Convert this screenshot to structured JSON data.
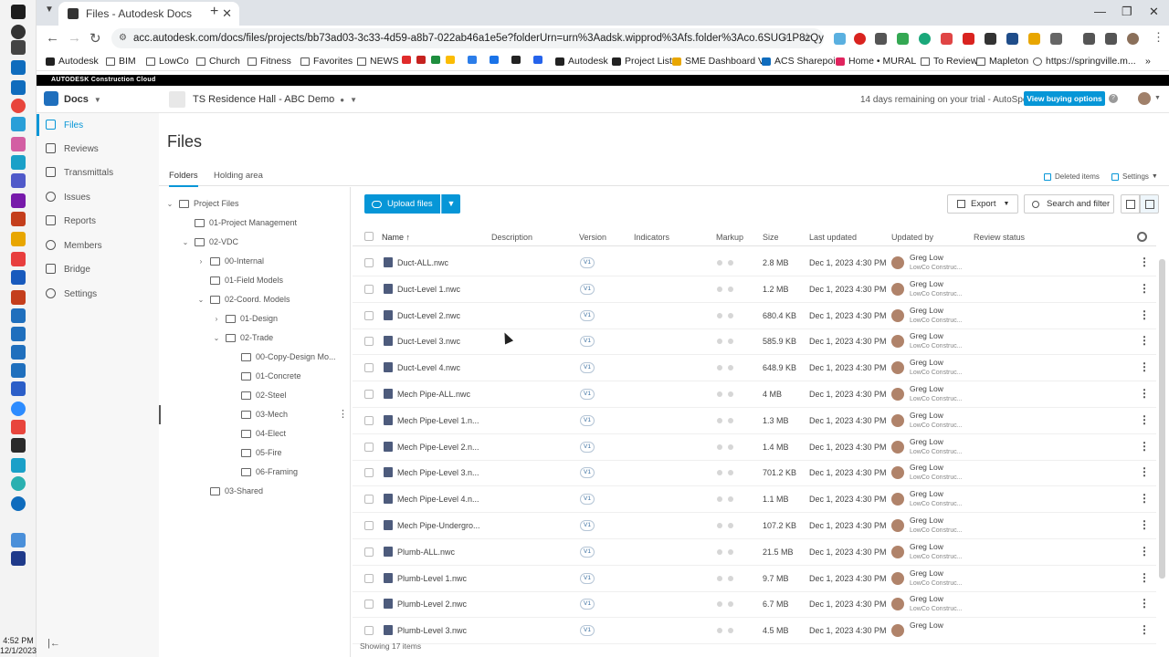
{
  "system": {
    "time": "4:52 PM",
    "date": "12/1/2023"
  },
  "browser": {
    "tab_title": "Files - Autodesk Docs",
    "url": "acc.autodesk.com/docs/files/projects/bb73ad03-3c33-4d59-a8b7-022ab46a1e5e?folderUrn=urn%3Aadsk.wipprod%3Afs.folder%3Aco.6SUG1P8zQySaFDJ7BnrHIA&viewM...",
    "bookmarks": [
      "Autodesk",
      "BIM",
      "LowCo",
      "Church",
      "Fitness",
      "Favorites",
      "NEWS",
      "Autodesk",
      "Project List",
      "SME Dashboard V3",
      "ACS Sharepoint",
      "Home • MURAL",
      "To Review",
      "Mapleton",
      "https://springville.m..."
    ]
  },
  "acc": {
    "brand_bar": "AUTODESK Construction Cloud",
    "module": "Docs",
    "project": "TS Residence Hall - ABC Demo",
    "trial_text": "14 days remaining on your trial - AutoSpecs",
    "buy_button": "View buying options",
    "help": "?"
  },
  "nav": {
    "items": [
      {
        "label": "Files",
        "active": true
      },
      {
        "label": "Reviews"
      },
      {
        "label": "Transmittals"
      },
      {
        "label": "Issues"
      },
      {
        "label": "Reports"
      },
      {
        "label": "Members"
      },
      {
        "label": "Bridge"
      },
      {
        "label": "Settings"
      }
    ]
  },
  "page": {
    "title": "Files",
    "tabs": [
      "Folders",
      "Holding area"
    ],
    "deleted_items": "Deleted items",
    "settings": "Settings"
  },
  "tree": [
    {
      "label": "Project Files",
      "depth": 0,
      "chevron": "v"
    },
    {
      "label": "01-Project Management",
      "depth": 1,
      "chevron": ""
    },
    {
      "label": "02-VDC",
      "depth": 1,
      "chevron": "v"
    },
    {
      "label": "00-Internal",
      "depth": 2,
      "chevron": ">"
    },
    {
      "label": "01-Field Models",
      "depth": 2,
      "chevron": ""
    },
    {
      "label": "02-Coord. Models",
      "depth": 2,
      "chevron": "v"
    },
    {
      "label": "01-Design",
      "depth": 3,
      "chevron": ">"
    },
    {
      "label": "02-Trade",
      "depth": 3,
      "chevron": "v"
    },
    {
      "label": "00-Copy-Design Mo...",
      "depth": 4,
      "chevron": ""
    },
    {
      "label": "01-Concrete",
      "depth": 4,
      "chevron": ""
    },
    {
      "label": "02-Steel",
      "depth": 4,
      "chevron": ""
    },
    {
      "label": "03-Mech",
      "depth": 4,
      "chevron": "",
      "selected": true
    },
    {
      "label": "04-Elect",
      "depth": 4,
      "chevron": ""
    },
    {
      "label": "05-Fire",
      "depth": 4,
      "chevron": ""
    },
    {
      "label": "06-Framing",
      "depth": 4,
      "chevron": ""
    },
    {
      "label": "03-Shared",
      "depth": 2,
      "chevron": ""
    }
  ],
  "toolbar": {
    "upload": "Upload files",
    "export": "Export",
    "search": "Search and filter"
  },
  "table": {
    "columns": {
      "name": "Name",
      "sort_arrow": "↑",
      "description": "Description",
      "version": "Version",
      "indicators": "Indicators",
      "markup": "Markup",
      "size": "Size",
      "last_updated": "Last updated",
      "updated_by": "Updated by",
      "review_status": "Review status"
    },
    "rows": [
      {
        "name": "Duct-ALL.nwc",
        "version": "V1",
        "size": "2.8 MB",
        "updated": "Dec 1, 2023 4:30 PM",
        "by": "Greg Low",
        "org": "LowCo Construc..."
      },
      {
        "name": "Duct-Level 1.nwc",
        "version": "V1",
        "size": "1.2 MB",
        "updated": "Dec 1, 2023 4:30 PM",
        "by": "Greg Low",
        "org": "LowCo Construc..."
      },
      {
        "name": "Duct-Level 2.nwc",
        "version": "V1",
        "size": "680.4 KB",
        "updated": "Dec 1, 2023 4:30 PM",
        "by": "Greg Low",
        "org": "LowCo Construc..."
      },
      {
        "name": "Duct-Level 3.nwc",
        "version": "V1",
        "size": "585.9 KB",
        "updated": "Dec 1, 2023 4:30 PM",
        "by": "Greg Low",
        "org": "LowCo Construc..."
      },
      {
        "name": "Duct-Level 4.nwc",
        "version": "V1",
        "size": "648.9 KB",
        "updated": "Dec 1, 2023 4:30 PM",
        "by": "Greg Low",
        "org": "LowCo Construc..."
      },
      {
        "name": "Mech Pipe-ALL.nwc",
        "version": "V1",
        "size": "4 MB",
        "updated": "Dec 1, 2023 4:30 PM",
        "by": "Greg Low",
        "org": "LowCo Construc..."
      },
      {
        "name": "Mech Pipe-Level 1.n...",
        "version": "V1",
        "size": "1.3 MB",
        "updated": "Dec 1, 2023 4:30 PM",
        "by": "Greg Low",
        "org": "LowCo Construc..."
      },
      {
        "name": "Mech Pipe-Level 2.n...",
        "version": "V1",
        "size": "1.4 MB",
        "updated": "Dec 1, 2023 4:30 PM",
        "by": "Greg Low",
        "org": "LowCo Construc..."
      },
      {
        "name": "Mech Pipe-Level 3.n...",
        "version": "V1",
        "size": "701.2 KB",
        "updated": "Dec 1, 2023 4:30 PM",
        "by": "Greg Low",
        "org": "LowCo Construc..."
      },
      {
        "name": "Mech Pipe-Level 4.n...",
        "version": "V1",
        "size": "1.1 MB",
        "updated": "Dec 1, 2023 4:30 PM",
        "by": "Greg Low",
        "org": "LowCo Construc..."
      },
      {
        "name": "Mech Pipe-Undergro...",
        "version": "V1",
        "size": "107.2 KB",
        "updated": "Dec 1, 2023 4:30 PM",
        "by": "Greg Low",
        "org": "LowCo Construc..."
      },
      {
        "name": "Plumb-ALL.nwc",
        "version": "V1",
        "size": "21.5 MB",
        "updated": "Dec 1, 2023 4:30 PM",
        "by": "Greg Low",
        "org": "LowCo Construc..."
      },
      {
        "name": "Plumb-Level 1.nwc",
        "version": "V1",
        "size": "9.7 MB",
        "updated": "Dec 1, 2023 4:30 PM",
        "by": "Greg Low",
        "org": "LowCo Construc..."
      },
      {
        "name": "Plumb-Level 2.nwc",
        "version": "V1",
        "size": "6.7 MB",
        "updated": "Dec 1, 2023 4:30 PM",
        "by": "Greg Low",
        "org": "LowCo Construc..."
      },
      {
        "name": "Plumb-Level 3.nwc",
        "version": "V1",
        "size": "4.5 MB",
        "updated": "Dec 1, 2023 4:30 PM",
        "by": "Greg Low",
        "org": ""
      }
    ],
    "footer": "Showing 17 items"
  },
  "colors": {
    "accent": "#0696d7",
    "file_icon": "#4d5b7c"
  }
}
